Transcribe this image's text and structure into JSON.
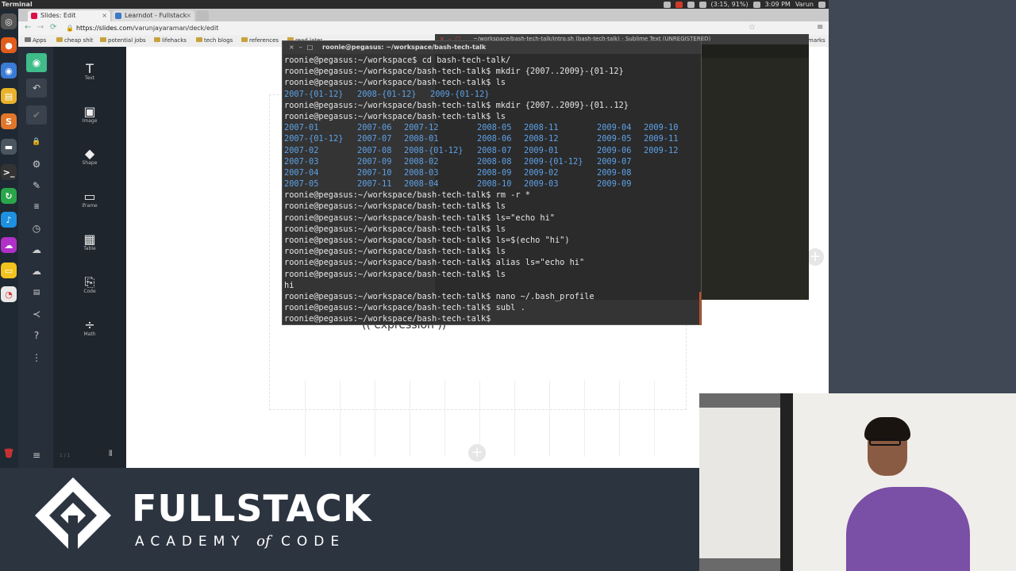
{
  "os_topbar": {
    "app_name": "Terminal",
    "battery": "(3:15, 91%)",
    "clock": "3:09 PM",
    "user": "Varun"
  },
  "browser": {
    "tabs": [
      {
        "title": "Slides: Edit",
        "active": true
      },
      {
        "title": "Learndot - Fullstack",
        "active": false
      }
    ],
    "url_host": "https://slides.com",
    "url_path": "/varunjayaraman/deck/edit",
    "bookmarks": [
      "Apps",
      "cheap shit",
      "potential jobs",
      "lifehacks",
      "tech blogs",
      "references",
      "read later",
      "marks"
    ]
  },
  "slides_toolbox": {
    "tools": [
      {
        "icon": "T",
        "label": "Text"
      },
      {
        "icon": "▣",
        "label": "Image"
      },
      {
        "icon": "◆",
        "label": "Shape"
      },
      {
        "icon": "▭",
        "label": "iframe"
      },
      {
        "icon": "▦",
        "label": "Table"
      },
      {
        "icon": "⎘",
        "label": "Code"
      },
      {
        "icon": "÷",
        "label": "Math"
      }
    ],
    "footer_hint": "1 / 1"
  },
  "slide": {
    "expression_text": "(( expression ))"
  },
  "sublime": {
    "title": "~/workspace/bash-tech-talk/intro.sh (bash-tech-talk) - Sublime Text (UNREGISTERED)"
  },
  "terminal": {
    "title": "roonie@pegasus: ~/workspace/bash-tech-talk",
    "prompt_base": "roonie@pegasus:~/workspace$ ",
    "prompt": "roonie@pegasus:~/workspace/bash-tech-talk$ ",
    "lines": [
      {
        "type": "cmd",
        "prompt": "roonie@pegasus:~/workspace$ ",
        "cmd": "cd bash-tech-talk/"
      },
      {
        "type": "cmd",
        "prompt": "roonie@pegasus:~/workspace/bash-tech-talk$ ",
        "cmd": "mkdir {2007..2009}-{01-12}"
      },
      {
        "type": "cmd",
        "prompt": "roonie@pegasus:~/workspace/bash-tech-talk$ ",
        "cmd": "ls"
      },
      {
        "type": "ls",
        "cols": [
          "2007-{01-12}",
          "2008-{01-12}",
          "2009-{01-12}"
        ]
      },
      {
        "type": "cmd",
        "prompt": "roonie@pegasus:~/workspace/bash-tech-talk$ ",
        "cmd": "mkdir {2007..2009}-{01..12}"
      },
      {
        "type": "cmd",
        "prompt": "roonie@pegasus:~/workspace/bash-tech-talk$ ",
        "cmd": "ls"
      },
      {
        "type": "ls",
        "cols": [
          "2007-01",
          "2007-06",
          "2007-12",
          "2008-05",
          "2008-11",
          "2009-04",
          "2009-10"
        ]
      },
      {
        "type": "ls",
        "cols": [
          "2007-{01-12}",
          "2007-07",
          "2008-01",
          "2008-06",
          "2008-12",
          "2009-05",
          "2009-11"
        ]
      },
      {
        "type": "ls",
        "cols": [
          "2007-02",
          "2007-08",
          "2008-{01-12}",
          "2008-07",
          "2009-01",
          "2009-06",
          "2009-12"
        ]
      },
      {
        "type": "ls",
        "cols": [
          "2007-03",
          "2007-09",
          "2008-02",
          "2008-08",
          "2009-{01-12}",
          "2009-07",
          ""
        ]
      },
      {
        "type": "ls",
        "cols": [
          "2007-04",
          "2007-10",
          "2008-03",
          "2008-09",
          "2009-02",
          "2009-08",
          ""
        ]
      },
      {
        "type": "ls",
        "cols": [
          "2007-05",
          "2007-11",
          "2008-04",
          "2008-10",
          "2009-03",
          "2009-09",
          ""
        ]
      },
      {
        "type": "cmd",
        "prompt": "roonie@pegasus:~/workspace/bash-tech-talk$ ",
        "cmd": "rm -r *"
      },
      {
        "type": "cmd",
        "prompt": "roonie@pegasus:~/workspace/bash-tech-talk$ ",
        "cmd": "ls"
      },
      {
        "type": "cmd",
        "prompt": "roonie@pegasus:~/workspace/bash-tech-talk$ ",
        "cmd": "ls=\"echo hi\""
      },
      {
        "type": "cmd",
        "prompt": "roonie@pegasus:~/workspace/bash-tech-talk$ ",
        "cmd": "ls"
      },
      {
        "type": "cmd",
        "prompt": "roonie@pegasus:~/workspace/bash-tech-talk$ ",
        "cmd": "ls=$(echo \"hi\")"
      },
      {
        "type": "cmd",
        "prompt": "roonie@pegasus:~/workspace/bash-tech-talk$ ",
        "cmd": "ls"
      },
      {
        "type": "cmd",
        "prompt": "roonie@pegasus:~/workspace/bash-tech-talk$ ",
        "cmd": "alias ls=\"echo hi\""
      },
      {
        "type": "cmd",
        "prompt": "roonie@pegasus:~/workspace/bash-tech-talk$ ",
        "cmd": "ls"
      },
      {
        "type": "out",
        "text": "hi"
      },
      {
        "type": "cmd",
        "prompt": "roonie@pegasus:~/workspace/bash-tech-talk$ ",
        "cmd": "nano ~/.bash_profile"
      },
      {
        "type": "cmd",
        "prompt": "roonie@pegasus:~/workspace/bash-tech-talk$ ",
        "cmd": "subl ."
      },
      {
        "type": "cmd",
        "prompt": "roonie@pegasus:~/workspace/bash-tech-talk$ ",
        "cmd": ""
      }
    ]
  },
  "branding": {
    "wordmark": "FULLSTACK",
    "sub_left": "ACADEMY",
    "sub_of": "of",
    "sub_right": "CODE"
  },
  "colors": {
    "ls_blue": "#5ea2e8",
    "slides_accent": "#3fbc8a",
    "terminal_bg": "#2c2c2c",
    "footer_bg": "#2c3440"
  }
}
